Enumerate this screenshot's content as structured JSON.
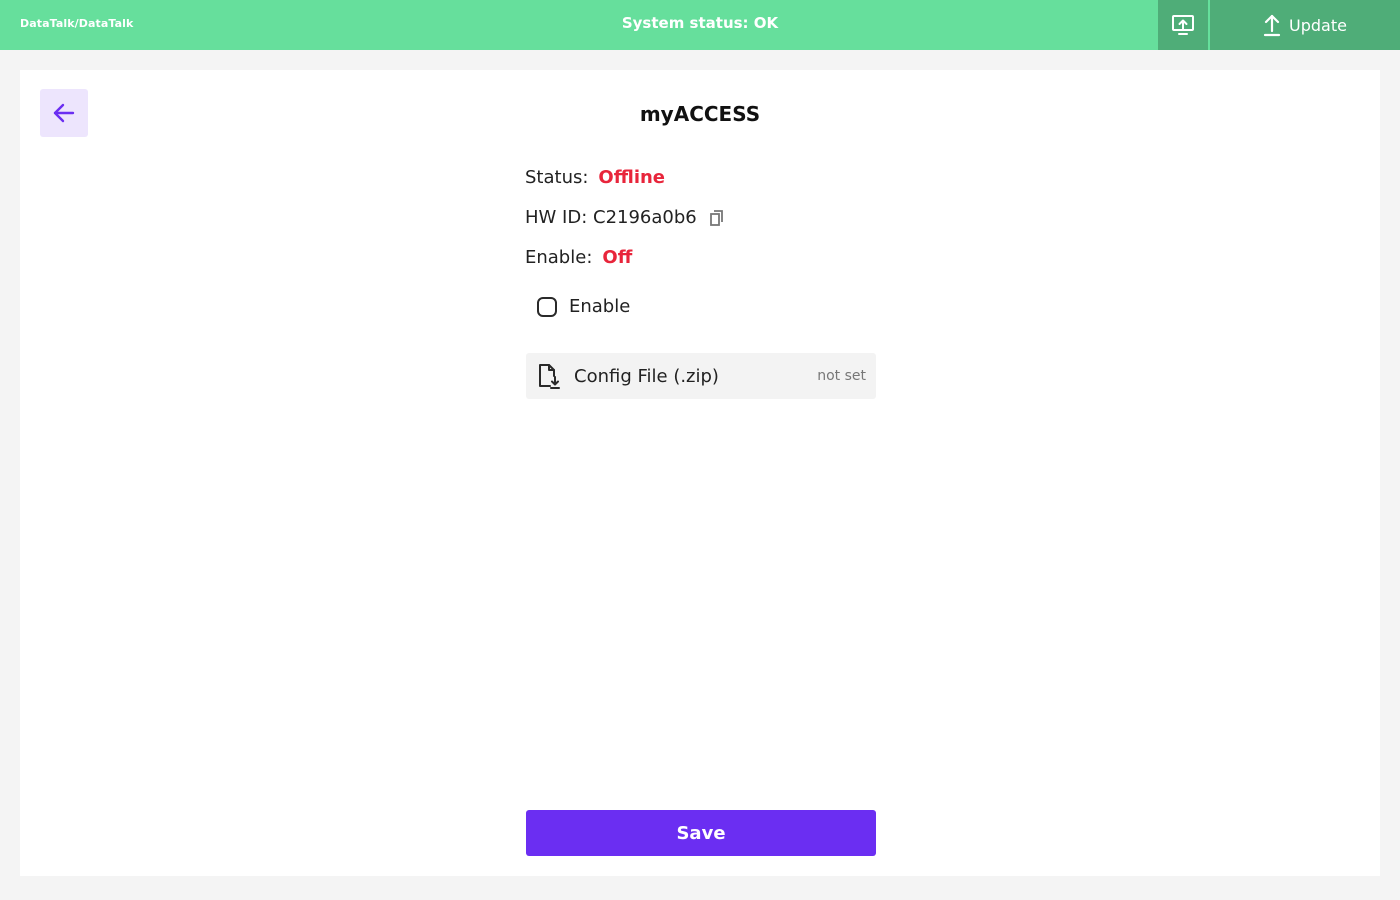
{
  "header": {
    "breadcrumb": "DataTalk/DataTalk",
    "system_status": "System status: OK",
    "update_label": "Update",
    "upload_icon": "monitor-upload-icon",
    "update_icon": "arrow-up-icon"
  },
  "page": {
    "title": "myACCESS",
    "back_icon": "arrow-left-icon"
  },
  "details": {
    "status_label": "Status:",
    "status_value": "Offline",
    "hwid_label": "HW ID: C2196a0b6",
    "enable_label": "Enable:",
    "enable_value": "Off"
  },
  "form": {
    "enable_checkbox_label": "Enable",
    "enable_checked": false,
    "config_file_label": "Config File (.zip)",
    "config_file_value": "not set",
    "save_label": "Save"
  },
  "colors": {
    "header_bg": "#66df9c",
    "header_button_bg": "#4fad78",
    "accent": "#6b2ef2",
    "error_red": "#e8253b"
  }
}
